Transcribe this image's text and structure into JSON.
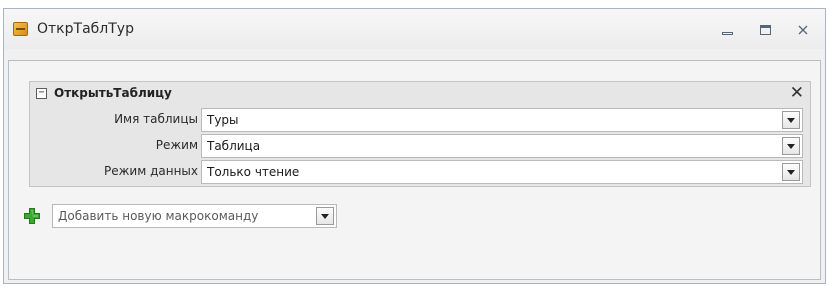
{
  "window": {
    "title": "ОткрТаблТур",
    "controls": {
      "minimize_icon": "minimize-icon",
      "maximize_icon": "maximize-icon",
      "close_glyph": "☒"
    }
  },
  "action": {
    "name": "ОткрытьТаблицу",
    "collapse_glyph": "⊟",
    "remove_glyph": "✕",
    "arguments": [
      {
        "label": "Имя таблицы",
        "value": "Туры"
      },
      {
        "label": "Режим",
        "value": "Таблица"
      },
      {
        "label": "Режим данных",
        "value": "Только чтение"
      }
    ]
  },
  "add_action": {
    "placeholder": "Добавить новую макрокоманду",
    "icon": "green-plus-icon"
  },
  "colors": {
    "accent_plus": "#3aa832",
    "border": "#b9b9b9"
  }
}
